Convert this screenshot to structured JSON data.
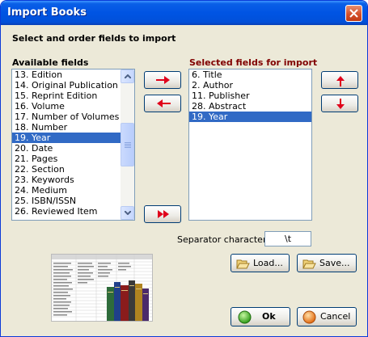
{
  "window": {
    "title": "Import Books"
  },
  "heading": "Select and order fields to import",
  "available": {
    "label": "Available fields",
    "items": [
      "13. Edition",
      "14. Original Publication",
      "15. Reprint Edition",
      "16. Volume",
      "17. Number of Volumes",
      "18. Number",
      "19. Year",
      "20. Date",
      "21. Pages",
      "22. Section",
      "23. Keywords",
      "24. Medium",
      "25. ISBN/ISSN",
      "26. Reviewed Item"
    ],
    "selected_index": 6
  },
  "selected": {
    "label": "Selected fields for import",
    "items": [
      "6. Title",
      "2. Author",
      "11. Publisher",
      "28. Abstract",
      "19. Year"
    ],
    "selected_index": 4
  },
  "separator": {
    "label": "Separator character",
    "value": "\\t"
  },
  "buttons": {
    "load": "Load...",
    "save": "Save...",
    "ok": "Ok",
    "cancel": "Cancel"
  },
  "colors": {
    "arrow_red": "#e0001b",
    "selection_blue": "#316ac5",
    "title_blue": "#0054e3"
  },
  "icons": {
    "add": "arrow-right-icon",
    "remove": "arrow-left-icon",
    "add_all": "double-arrow-right-icon",
    "move_up": "arrow-up-icon",
    "move_down": "arrow-down-icon",
    "load": "folder-icon",
    "save": "folder-icon",
    "ok": "green-circle-icon",
    "cancel": "orange-circle-icon"
  }
}
